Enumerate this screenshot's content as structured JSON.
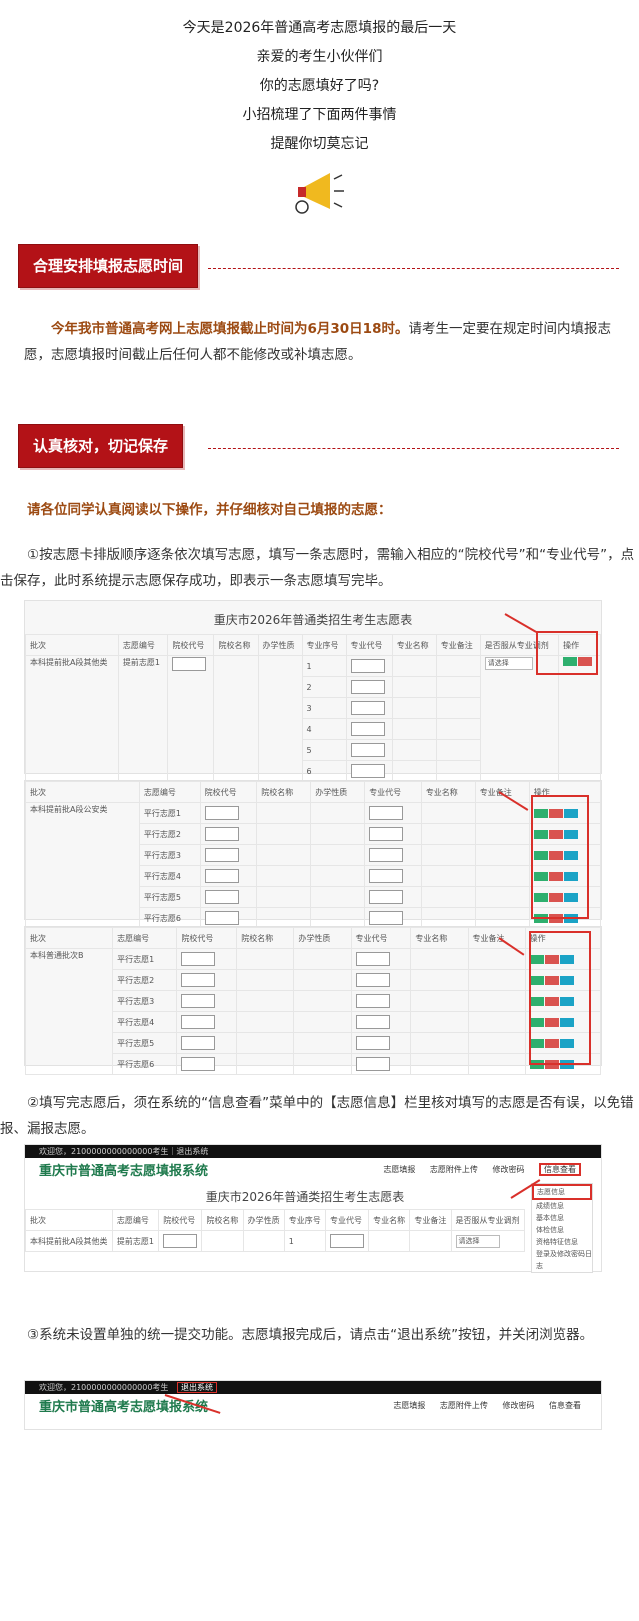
{
  "intro": {
    "line1": "今天是2026年普通高考志愿填报的最后一天",
    "line2": "亲爱的考生小伙伴们",
    "line3": "你的志愿填好了吗?",
    "line4": "小招梳理了下面两件事情",
    "line5": "提醒你切莫忘记",
    "icon": "megaphone-icon"
  },
  "section1": {
    "title": "合理安排填报志愿时间",
    "highlight": "今年我市普通高考网上志愿填报截止时间为6月30日18时。",
    "body": "请考生一定要在规定时间内填报志愿，志愿填报时间截止后任何人都不能修改或补填志愿。"
  },
  "section2": {
    "title": "认真核对，切记保存",
    "intro": "请各位同学认真阅读以下操作，并仔细核对自己填报的志愿：",
    "step1": "①按志愿卡排版顺序逐条依次填写志愿，填写一条志愿时，需输入相应的“院校代号”和“专业代号”，点击保存，此时系统提示志愿保存成功，即表示一条志愿填写完毕。",
    "step2": "②填写完志愿后，须在系统的“信息查看”菜单中的【志愿信息】栏里核对填写的志愿是否有误，以免错报、漏报志愿。",
    "step3": "③系统未设置单独的统一提交功能。志愿填报完成后，请点击“退出系统”按钮，并关闭浏览器。"
  },
  "shot1": {
    "title": "重庆市2026年普通类招生考生志愿表",
    "headers": [
      "批次",
      "志愿编号",
      "院校代号",
      "院校名称",
      "办学性质",
      "专业序号",
      "专业代号",
      "专业名称",
      "专业备注",
      "是否服从专业调剂",
      "操作"
    ],
    "batch": "本科提前批A段其他类",
    "vol": "提前志愿1",
    "select": "请选择",
    "seq": [
      "1",
      "2",
      "3",
      "4",
      "5",
      "6"
    ]
  },
  "shot2": {
    "headers": [
      "批次",
      "志愿编号",
      "院校代号",
      "院校名称",
      "办学性质",
      "专业代号",
      "专业名称",
      "专业备注",
      "操作"
    ],
    "batch": "本科提前批A段公安类",
    "vols": [
      "平行志愿1",
      "平行志愿2",
      "平行志愿3",
      "平行志愿4",
      "平行志愿5",
      "平行志愿6"
    ]
  },
  "shot3": {
    "headers": [
      "批次",
      "志愿编号",
      "院校代号",
      "院校名称",
      "办学性质",
      "专业代号",
      "专业名称",
      "专业备注",
      "操作"
    ],
    "batch": "本科普通批次B",
    "vols": [
      "平行志愿1",
      "平行志愿2",
      "平行志愿3",
      "平行志愿4",
      "平行志愿5",
      "平行志愿6"
    ]
  },
  "shot4": {
    "topbar": "欢迎您，2100000000000000考生｜退出系统",
    "systitle": "重庆市普通高考志愿填报系统",
    "nav": [
      "志愿填报",
      "志愿附件上传",
      "修改密码",
      "信息查看"
    ],
    "menu": [
      "志愿信息",
      "成绩信息",
      "基本信息",
      "体检信息",
      "资格特征信息",
      "登录及修改密码日志"
    ],
    "title": "重庆市2026年普通类招生考生志愿表",
    "headers": [
      "批次",
      "志愿编号",
      "院校代号",
      "院校名称",
      "办学性质",
      "专业序号",
      "专业代号",
      "专业名称",
      "专业备注",
      "是否服从专业调剂"
    ],
    "batch": "本科提前批A段其他类",
    "vol": "提前志愿1",
    "select": "请选择"
  },
  "shot5": {
    "topbar": "欢迎您，2100000000000000考生",
    "logout": "退出系统",
    "systitle": "重庆市普通高考志愿填报系统",
    "nav": [
      "志愿填报",
      "志愿附件上传",
      "修改密码",
      "信息查看"
    ]
  },
  "colors": {
    "accent": "#b31217",
    "highlight": "#9c4a12",
    "save": "#2eaf6e",
    "delete": "#d9534f",
    "up": "#1ba3c6",
    "red_mark": "#d9302a"
  }
}
